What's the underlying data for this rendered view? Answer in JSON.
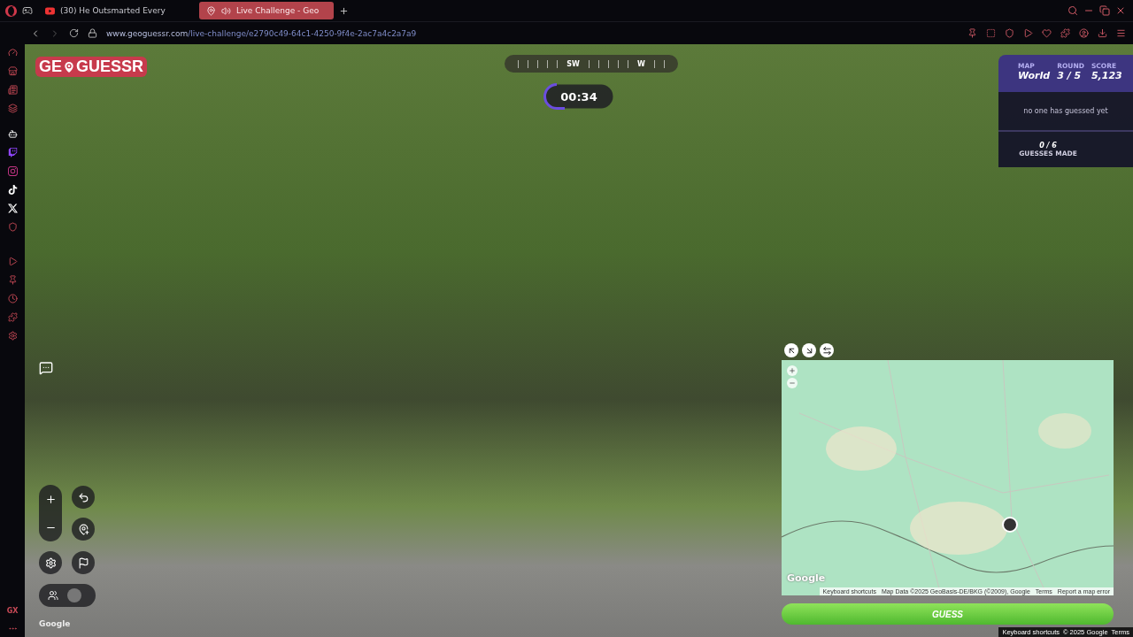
{
  "browser": {
    "tabs": [
      {
        "kind": "video",
        "label": "(30) He Outsmarted Every",
        "selected": false
      },
      {
        "kind": "game",
        "label": "Live Challenge - Geo",
        "selected": true
      }
    ],
    "url": {
      "host": "www.geoguessr.com",
      "path": "/live-challenge/e2790c49-64c1-4250-9f4e-2ac7a4c2a7a9"
    },
    "sidebar_footer": "GX"
  },
  "game": {
    "logo": {
      "left": "GE",
      "right": "GUESSR"
    },
    "compass": [
      "SW",
      "W"
    ],
    "timer": {
      "time": "00:34",
      "level": 0.3
    },
    "stats": [
      {
        "label": "MAP",
        "value": "World"
      },
      {
        "label": "ROUND",
        "value": "3 / 5"
      },
      {
        "label": "SCORE",
        "value": "5,123"
      }
    ],
    "guesses_note": "no one has guessed yet",
    "guesses": {
      "count": "0 / 6",
      "label": "GUESSES MADE"
    },
    "photo_credit": "Google",
    "map_logo": "Google",
    "map": {
      "attribution": [
        "Keyboard shortcuts",
        "Map Data ©2025 GeoBasis-DE/BKG (©2009), Google",
        "Terms",
        "Report a map error"
      ]
    },
    "guess_button": "GUESS",
    "footer": [
      "Keyboard shortcuts",
      "© 2025 Google",
      "Terms"
    ]
  }
}
